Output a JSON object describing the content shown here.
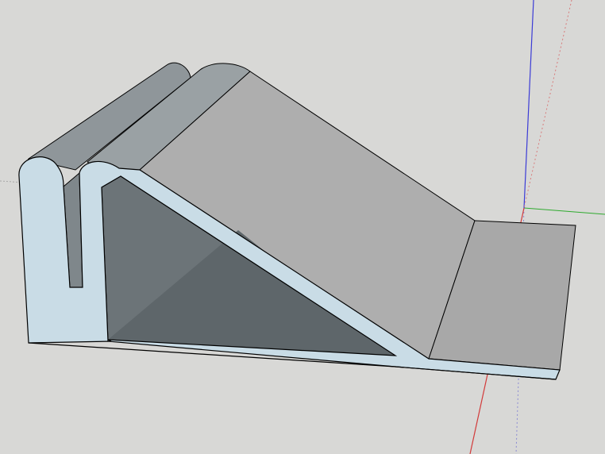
{
  "viewport": {
    "background_color": "#d8d8d6"
  },
  "axes": {
    "red_axis_color": "#d23a3a",
    "green_axis_color": "#2faa2f",
    "blue_axis_color": "#3b3bd6",
    "gray_axis_color": "#a8a8a8"
  },
  "model": {
    "name_icon": "stand-profile-3d-model",
    "face_colors": {
      "light_blue_face": "#c9dce6",
      "top_face": "#aeaeae",
      "top_face_dark": "#9e9e9e",
      "inner_face": "#737b80",
      "inner_face_dark": "#5f676b",
      "cylinder_face": "#8f969a",
      "edge": "#000000"
    }
  }
}
